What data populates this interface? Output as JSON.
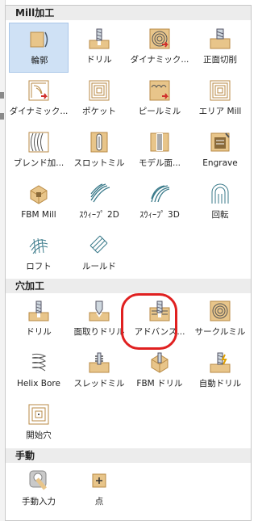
{
  "colors": {
    "tan": "#e8c58a",
    "tan_dark": "#b88a45",
    "metal": "#8aa0b0",
    "arrow_red": "#d0312d",
    "highlight_red": "#e02020",
    "selected_bg": "#cfe1f5"
  },
  "sections": {
    "mill": {
      "title": "Mill加工",
      "items": [
        {
          "label": "輪郭",
          "icon": "contour-icon",
          "selected": true
        },
        {
          "label": "ドリル",
          "icon": "drill-icon"
        },
        {
          "label": "ダイナミック...",
          "icon": "dynamic-spiral-icon"
        },
        {
          "label": "正面切削",
          "icon": "face-mill-icon"
        },
        {
          "label": "ダイナミック...",
          "icon": "dynamic-contour-icon"
        },
        {
          "label": "ポケット",
          "icon": "pocket-icon"
        },
        {
          "label": "ピールミル",
          "icon": "peel-mill-icon"
        },
        {
          "label": "エリア Mill",
          "icon": "area-mill-icon"
        },
        {
          "label": "ブレンド加...",
          "icon": "blend-icon"
        },
        {
          "label": "スロットミル",
          "icon": "slot-mill-icon"
        },
        {
          "label": "モデル面...",
          "icon": "model-face-icon"
        },
        {
          "label": "Engrave",
          "icon": "engrave-icon"
        },
        {
          "label": "FBM Mill",
          "icon": "fbm-mill-icon"
        },
        {
          "label": "ｽｳｨｰﾌﾟ 2D",
          "icon": "sweep-2d-icon"
        },
        {
          "label": "ｽｳｨｰﾌﾟ 3D",
          "icon": "sweep-3d-icon"
        },
        {
          "label": "回転",
          "icon": "rotary-icon"
        },
        {
          "label": "ロフト",
          "icon": "loft-icon"
        },
        {
          "label": "ルールド",
          "icon": "ruled-icon"
        }
      ]
    },
    "hole": {
      "title": "穴加工",
      "items": [
        {
          "label": "ドリル",
          "icon": "drill-icon"
        },
        {
          "label": "面取りドリル",
          "icon": "chamfer-drill-icon"
        },
        {
          "label": "アドバンス...",
          "icon": "advanced-drill-icon"
        },
        {
          "label": "サークルミル",
          "icon": "circle-mill-icon"
        },
        {
          "label": "Helix Bore",
          "icon": "helix-bore-icon"
        },
        {
          "label": "スレッドミル",
          "icon": "thread-mill-icon"
        },
        {
          "label": "FBM ドリル",
          "icon": "fbm-drill-icon"
        },
        {
          "label": "自動ドリル",
          "icon": "auto-drill-icon"
        },
        {
          "label": "開始穴",
          "icon": "start-hole-icon"
        }
      ]
    },
    "manual": {
      "title": "手動",
      "items": [
        {
          "label": "手動入力",
          "icon": "manual-input-icon"
        },
        {
          "label": "点",
          "icon": "point-icon"
        }
      ]
    }
  }
}
